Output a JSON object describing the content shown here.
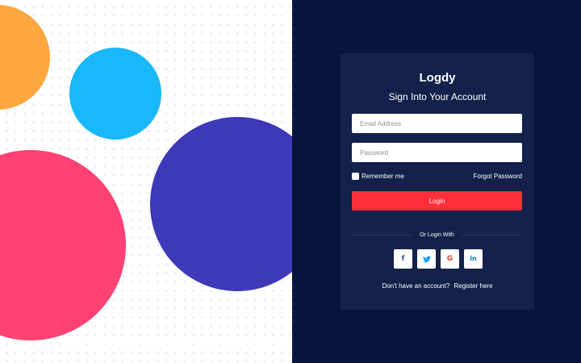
{
  "brand": {
    "name": "Logdy",
    "subtitle": "Sign Into Your Account"
  },
  "form": {
    "email_placeholder": "Email Address",
    "password_placeholder": "Password",
    "remember_label": "Remember me",
    "forgot_label": "Forgot Password",
    "login_label": "Login"
  },
  "social": {
    "divider_text": "Or Login With",
    "buttons": [
      {
        "icon": "facebook-icon",
        "glyph": "f"
      },
      {
        "icon": "twitter-icon",
        "glyph": "🐦"
      },
      {
        "icon": "google-icon",
        "glyph": "G"
      },
      {
        "icon": "linkedin-icon",
        "glyph": "in"
      }
    ]
  },
  "register": {
    "prompt": "Don't have an account?",
    "link_label": "Register here"
  },
  "colors": {
    "left_bg": "#FFFFFF",
    "right_bg": "#07143D",
    "card_bg": "#13214B",
    "login_button": "#FF2E3A",
    "circle_orange": "#FFA83F",
    "circle_cyan": "#19B8FA",
    "circle_pink": "#FF4273",
    "circle_indigo": "#3E39B9"
  }
}
